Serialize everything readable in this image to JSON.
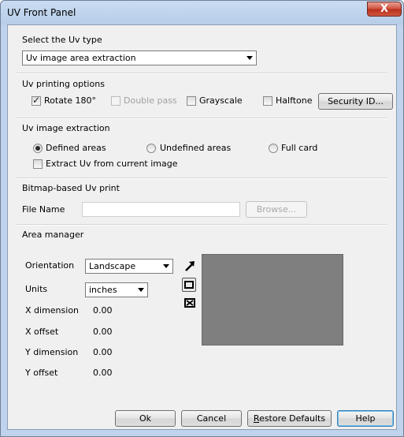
{
  "window": {
    "title": "UV Front Panel",
    "close": "X"
  },
  "uv_type": {
    "label": "Select the Uv type",
    "selected": "Uv image area extraction"
  },
  "printing_options": {
    "label": "Uv printing options",
    "rotate": "Rotate 180°",
    "double_pass": "Double pass",
    "grayscale": "Grayscale",
    "halftone": "Halftone",
    "security_button": "Security ID..."
  },
  "extraction": {
    "label": "Uv image extraction",
    "defined": "Defined areas",
    "undefined": "Undefined areas",
    "full_card": "Full card",
    "extract_current": "Extract Uv from current image"
  },
  "bitmap": {
    "label": "Bitmap-based Uv print",
    "file_name_label": "File Name",
    "file_name_value": "",
    "browse": "Browse..."
  },
  "area_manager": {
    "label": "Area manager",
    "orientation_label": "Orientation",
    "orientation_value": "Landscape",
    "units_label": "Units",
    "units_value": "inches",
    "x_dimension_label": "X dimension",
    "x_dimension_value": "0.00",
    "x_offset_label": "X offset",
    "x_offset_value": "0.00",
    "y_dimension_label": "Y dimension",
    "y_dimension_value": "0.00",
    "y_offset_label": "Y offset",
    "y_offset_value": "0.00"
  },
  "footer": {
    "ok": "Ok",
    "cancel": "Cancel",
    "restore_prefix": "",
    "restore_underline": "R",
    "restore_rest": "estore Defaults",
    "help": "Help"
  }
}
